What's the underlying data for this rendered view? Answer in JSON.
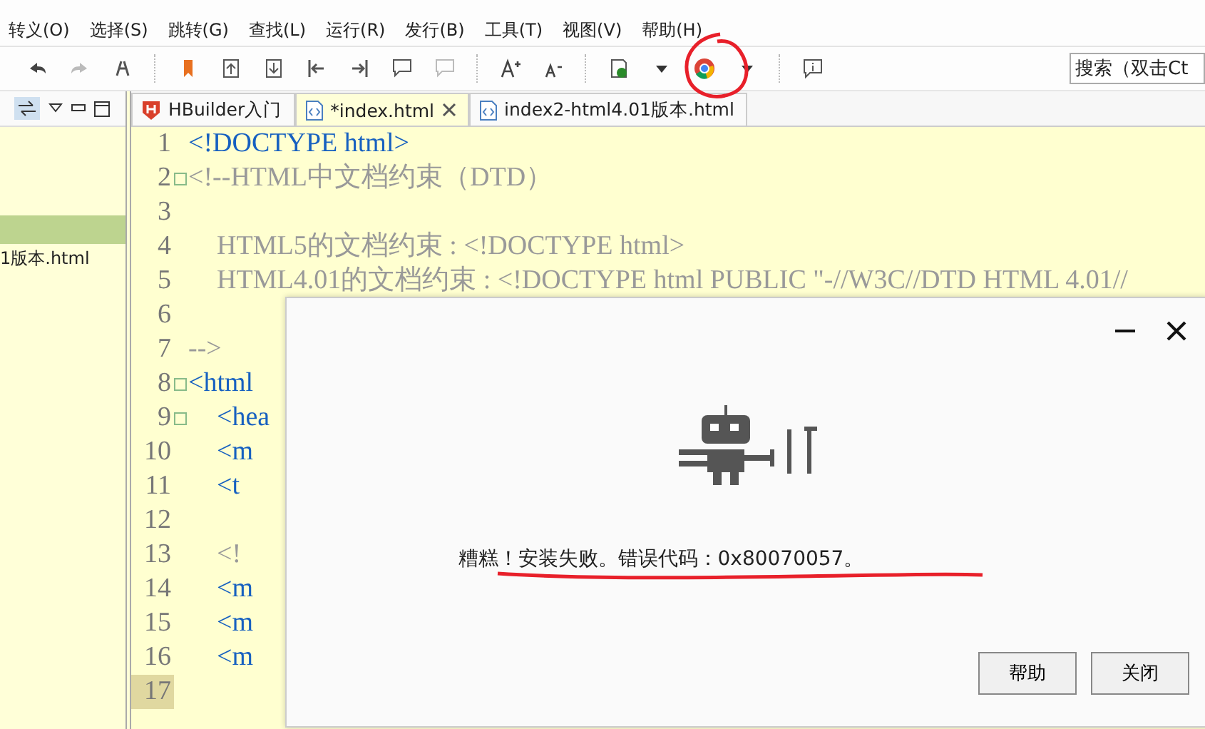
{
  "menu": [
    "转义(O)",
    "选择(S)",
    "跳转(G)",
    "查找(L)",
    "运行(R)",
    "发行(B)",
    "工具(T)",
    "视图(V)",
    "帮助(H)"
  ],
  "toolbar": {
    "search": {
      "placeholder": "搜索（双击Ct"
    }
  },
  "sidebar": {
    "items": [
      {
        "selected": true
      },
      {
        "label": "1版本.html",
        "selected": false
      }
    ]
  },
  "tabs": [
    {
      "label": "HBuilder入门",
      "kind": "hbuilder",
      "selected": false
    },
    {
      "label": "*index.html",
      "kind": "html",
      "selected": true
    },
    {
      "label": "index2-html4.01版本.html",
      "kind": "html",
      "selected": false
    }
  ],
  "editor": {
    "lines": [
      {
        "number": "1",
        "kind": "doctype",
        "text": "<!DOCTYPE html>",
        "foldable": false,
        "current": false
      },
      {
        "number": "2",
        "kind": "comment",
        "text": "<!--HTML中文档约束（DTD）",
        "foldable": true,
        "current": false,
        "children": [
          {
            "number": "3",
            "foldable": false,
            "current": false
          },
          {
            "number": "4",
            "kind": "comment",
            "text": "HTML5的文档约束 : <!DOCTYPE html>",
            "foldable": false,
            "current": false
          },
          {
            "number": "5",
            "kind": "comment",
            "text": "HTML4.01的文档约束 : <!DOCTYPE html PUBLIC \"-//W3C//DTD HTML 4.01//",
            "foldable": false,
            "current": false
          },
          {
            "number": "6",
            "foldable": false,
            "current": false
          }
        ]
      },
      {
        "number": "7",
        "kind": "comment",
        "text": "-->",
        "foldable": false,
        "current": false
      },
      {
        "number": "8",
        "kind": "tag",
        "text": "<html",
        "foldable": true,
        "current": false,
        "children": [
          {
            "number": "9",
            "kind": "tag",
            "text": "<hea",
            "foldable": true,
            "current": false,
            "children": [
              {
                "number": "10",
                "kind": "tag",
                "text": "<m",
                "foldable": false,
                "current": false
              },
              {
                "number": "11",
                "kind": "tag",
                "text": "<t",
                "foldable": false,
                "current": false
              },
              {
                "number": "12",
                "foldable": false,
                "current": false
              },
              {
                "number": "13",
                "kind": "comment",
                "text": "<!",
                "foldable": false,
                "current": false
              },
              {
                "number": "14",
                "kind": "tag",
                "text": "<m",
                "foldable": false,
                "current": false
              },
              {
                "number": "15",
                "kind": "tag",
                "text": "<m",
                "foldable": false,
                "current": false
              },
              {
                "number": "16",
                "kind": "tag",
                "text": "<m",
                "foldable": false,
                "current": false
              },
              {
                "number": "17",
                "foldable": false,
                "current": true
              }
            ]
          }
        ]
      }
    ]
  },
  "dialog": {
    "message": "糟糕！安装失败。错误代码：0x80070057。",
    "buttons": [
      "帮助",
      "关闭"
    ]
  }
}
